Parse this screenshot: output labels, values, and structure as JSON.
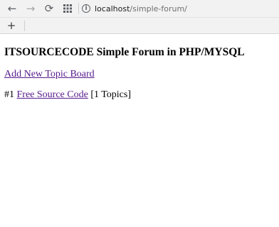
{
  "browser": {
    "back_icon": "back-arrow-icon",
    "forward_icon": "forward-arrow-icon",
    "reload_icon": "reload-icon",
    "apps_icon": "apps-grid-icon",
    "info_icon": "info-icon",
    "url_host": "localhost",
    "url_path": "/simple-forum/",
    "add_bookmark_icon": "plus-icon"
  },
  "page": {
    "title": "ITSOURCECODE Simple Forum in PHP/MYSQL",
    "add_topic_link": "Add New Topic Board",
    "boards": [
      {
        "number": "#1",
        "name": "Free Source Code",
        "topics": "[1 Topics]"
      }
    ]
  }
}
